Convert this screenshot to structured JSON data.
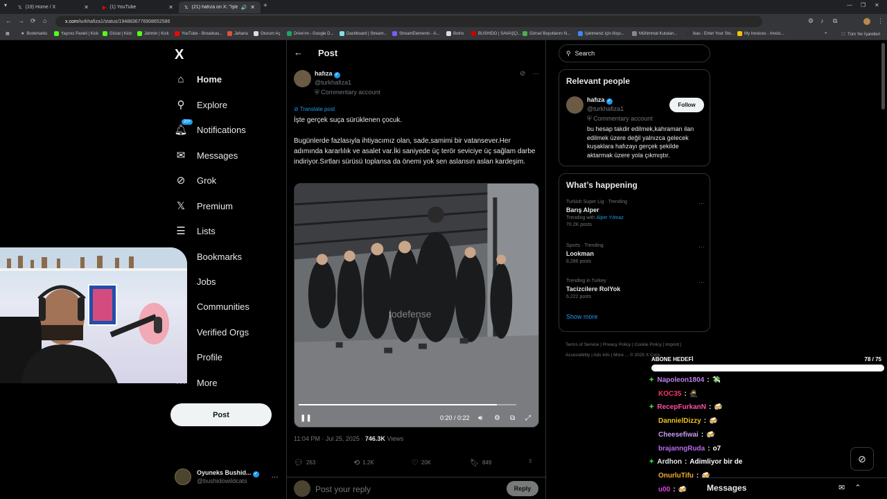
{
  "browser": {
    "tabs": [
      {
        "title": "(19) Home / X"
      },
      {
        "title": "(1) YouTube"
      },
      {
        "title": "(21) hafıza on X: \"İşte gerçe"
      }
    ],
    "url_domain": "x.com",
    "url_path": "/turkhafiza1/status/1948836776908652586",
    "bookmarks": [
      "Bookmarks",
      "Yayıncı Paneli | Kick",
      "Gözat | Kick",
      "Jahmin | Kick",
      "YouTube - Broadcas...",
      "Jaharia",
      "Oturum Aç",
      "Drive'ım - Google D...",
      "Dashboard | Stream...",
      "StreamElements - A...",
      "Botrix",
      "BUSHIDO | SAVAŞÇI...",
      "Görsel Boyutlarını N...",
      "İşletmeniz için Alışv...",
      "Mühimmat Kutuları...",
      "ikas - Enter Your Sto...",
      "My Invoices - Invoic...",
      "Tüm Yer İşaretleri"
    ]
  },
  "sidebar": {
    "logo": "X",
    "items": [
      {
        "label": "Home",
        "icon": "home-icon"
      },
      {
        "label": "Explore",
        "icon": "search-icon"
      },
      {
        "label": "Notifications",
        "icon": "bell-icon",
        "badge": "20+"
      },
      {
        "label": "Messages",
        "icon": "envelope-icon"
      },
      {
        "label": "Grok",
        "icon": "grok-icon"
      },
      {
        "label": "Premium",
        "icon": "x-icon"
      },
      {
        "label": "Lists",
        "icon": "list-icon"
      },
      {
        "label": "Bookmarks",
        "icon": "bookmark-icon"
      },
      {
        "label": "Jobs",
        "icon": "briefcase-icon"
      },
      {
        "label": "Communities",
        "icon": "people-icon"
      },
      {
        "label": "Verified Orgs",
        "icon": "lightning-icon"
      },
      {
        "label": "Profile",
        "icon": "person-icon"
      },
      {
        "label": "More",
        "icon": "more-circle-icon"
      }
    ],
    "post_label": "Post",
    "account": {
      "name": "Oyuneks Bushid...",
      "handle": "@bushidowildcats"
    }
  },
  "post": {
    "header_title": "Post",
    "author_name": "hafıza",
    "author_handle": "@turkhafiza1",
    "author_label": "Commentary account",
    "translate": "Translate post",
    "text_line1": "İşte gerçek suça sürüklenen çocuk.",
    "text_para": "Bugünlerde fazlasıyla ihtiyacımız olan, sade,samimi bir vatansever.Her adımında kararlılık ve asalet var.İki saniyede üç terör seviciye üç sağlam darbe indiriyor.Sırtları sürüsü toplansa da önemi yok sen aslansın aslan kardeşim.",
    "video": {
      "watermark": "todefense",
      "time": "0:20 / 0:22",
      "progress_fraction": 0.91
    },
    "time": "11:04 PM · Jul 25, 2025 · ",
    "views_count": "746.3K",
    "views_label": " Views",
    "replies": "263",
    "reposts": "1.2K",
    "likes": "20K",
    "bookmarks": "849",
    "reply_placeholder": "Post your reply",
    "reply_label": "Reply"
  },
  "right": {
    "search_placeholder": "Search",
    "relevant_title": "Relevant people",
    "person": {
      "name": "hafıza",
      "handle": "@turkhafiza1",
      "label": "Commentary account",
      "bio": "bu hesap takdir edilmek,kahraman ilan edilmek üzere değil yalnızca gelecek kuşaklara hafızayı gerçek şekilde aktarmak üzere yola çıkmıştır.",
      "follow": "Follow"
    },
    "happening_title": "What’s happening",
    "trends": [
      {
        "category": "Turkish Super Lig · Trending",
        "name": "Barış Alper",
        "with_label": "Trending with ",
        "with_name": "Alper Yılmaz",
        "posts": "70.2K posts"
      },
      {
        "category": "Sports · Trending",
        "name": "Lookman",
        "with_label": "",
        "with_name": "",
        "posts": "8,286 posts"
      },
      {
        "category": "Trending in Turkey",
        "name": "Tacizcilere RolYok",
        "with_label": "",
        "with_name": "",
        "posts": "6,222 posts"
      }
    ],
    "show_more": "Show more",
    "footer": "Terms of Service | Privacy Policy | Cookie Policy | Imprint | Accessibility | Ads info | More ... © 2025 X Corp."
  },
  "chat": {
    "goal_label": "ABONE HEDEFİ",
    "goal_count": "78 / 75",
    "goal_fraction": 1.0,
    "messages": [
      {
        "user": "Napoleon1804",
        "color": "#c07fe8",
        "text": "💸",
        "gem": true
      },
      {
        "user": "KOC35",
        "color": "#ff3366",
        "text": "🥷",
        "gem": false
      },
      {
        "user": "RecepFurkanN",
        "color": "#ff4fa8",
        "text": "🍻",
        "gem": true
      },
      {
        "user": "DannielDizzy",
        "color": "#f0c020",
        "text": "🍻",
        "gem": false
      },
      {
        "user": "Cheesefiwai",
        "color": "#c89cf0",
        "text": "🍻",
        "gem": false
      },
      {
        "user": "brajanngRuda",
        "color": "#b96cf0",
        "text": "o7",
        "gem": false
      },
      {
        "user": "Ardhon",
        "color": "#e7e9ea",
        "text": "Adimliyor bir de",
        "gem": true
      },
      {
        "user": "OnurluTifu",
        "color": "#f0b030",
        "text": "🍻",
        "gem": false
      },
      {
        "user": "u00",
        "color": "#e040e0",
        "text": "🍻",
        "gem": false
      }
    ],
    "messages_panel_label": "Messages"
  },
  "colors": {
    "accent": "#1d9bf0",
    "background": "#000000",
    "text": "#e7e9ea",
    "muted": "#71767b"
  }
}
